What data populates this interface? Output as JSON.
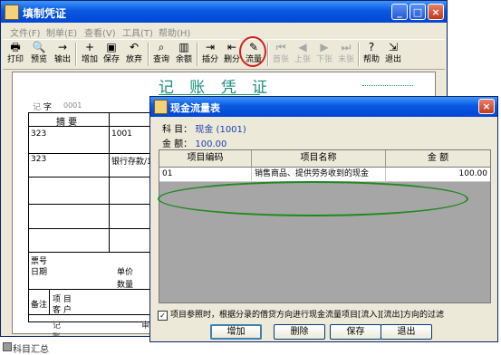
{
  "main_window": {
    "title": "填制凭证",
    "controls": {
      "minimize": "_",
      "maximize": "□",
      "close": "×"
    }
  },
  "menu": [
    "文件(F)",
    "制单(E)",
    "查看(V)",
    "工具(T)",
    "帮助(H)"
  ],
  "toolbar": [
    {
      "label": "打印",
      "icon": "print-icon",
      "glyph": "🖶",
      "enabled": true
    },
    {
      "label": "预览",
      "icon": "preview-icon",
      "glyph": "🔍",
      "enabled": true
    },
    {
      "label": "输出",
      "icon": "export-icon",
      "glyph": "→",
      "enabled": true
    },
    {
      "label": "增加",
      "icon": "add-icon",
      "glyph": "+",
      "enabled": true
    },
    {
      "label": "保存",
      "icon": "save-icon",
      "glyph": "▣",
      "enabled": true
    },
    {
      "label": "放弃",
      "icon": "undo-icon",
      "glyph": "↶",
      "enabled": true
    },
    {
      "label": "查询",
      "icon": "binoculars-icon",
      "glyph": "⌕",
      "enabled": true
    },
    {
      "label": "余额",
      "icon": "balance-chart-icon",
      "glyph": "▥",
      "enabled": true
    },
    {
      "label": "插分",
      "icon": "insert-entry-icon",
      "glyph": "⇥",
      "enabled": true
    },
    {
      "label": "删分",
      "icon": "delete-entry-icon",
      "glyph": "⇤",
      "enabled": true
    },
    {
      "label": "流量",
      "icon": "cash-flow-icon",
      "glyph": "✎",
      "enabled": true
    },
    {
      "label": "首张",
      "icon": "first-icon",
      "glyph": "⏮",
      "enabled": false
    },
    {
      "label": "上张",
      "icon": "previous-icon",
      "glyph": "◀",
      "enabled": false
    },
    {
      "label": "下张",
      "icon": "next-icon",
      "glyph": "▶",
      "enabled": false
    },
    {
      "label": "末张",
      "icon": "last-icon",
      "glyph": "⏭",
      "enabled": false
    },
    {
      "label": "帮助",
      "icon": "help-icon",
      "glyph": "?",
      "enabled": true
    },
    {
      "label": "退出",
      "icon": "exit-icon",
      "glyph": "⇲",
      "enabled": true
    }
  ],
  "voucher": {
    "title": "记 账 凭 证",
    "word_label": "记",
    "word_suffix": "字",
    "number": "0001",
    "header_summary": "摘 要",
    "rows": [
      {
        "summary": "323",
        "account": "1001"
      },
      {
        "summary": "323",
        "account": "银行存款/1"
      }
    ],
    "ticket_no_label": "票号",
    "date_label": "日期",
    "unit_price_label": "单价",
    "quantity_label": "数量",
    "remark_label": "备注",
    "item_label": "项 目",
    "customer_label": "客 户",
    "bookkeeper_label": "记账",
    "reviewer_label": "审"
  },
  "status_bar": {
    "summary": "科目汇总"
  },
  "dialog": {
    "title": "现金流量表",
    "subject_label": "科 目：",
    "subject_value": "现金 (1001)",
    "amount_label": "金 额：",
    "amount_value": "100.00",
    "columns": [
      "项目编码",
      "项目名称",
      "金 额"
    ],
    "rows": [
      {
        "code": "01",
        "name": "销售商品、提供劳务收到的现金",
        "amount": "100.00"
      }
    ],
    "filter_checked": true,
    "filter_text": "项目参照时，根据分录的借贷方向进行现金流量项目[流入][流出]方向的过滤",
    "buttons": [
      "增加",
      "删除",
      "保存",
      "退出"
    ],
    "close": "×"
  },
  "colors": {
    "title_bar": "#0a58e0",
    "voucher_title": "#1a8f7d",
    "highlight_ellipse": "#1f8a1f",
    "info_value": "#1c3fae"
  }
}
